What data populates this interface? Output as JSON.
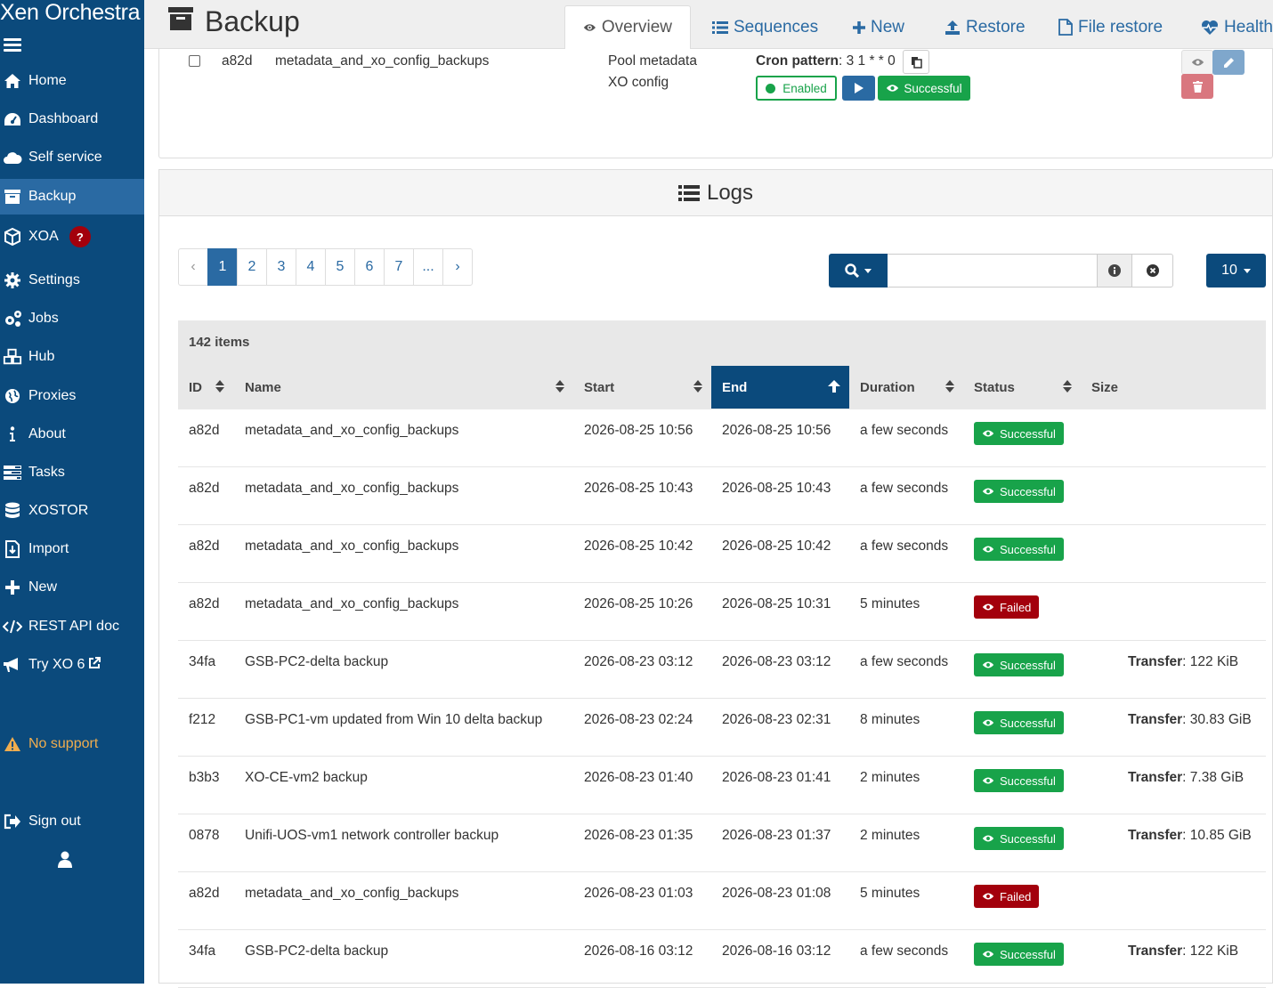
{
  "app": {
    "brand": "Xen Orchestra"
  },
  "sidebar": {
    "items": [
      {
        "label": "Home",
        "icon": "home-icon"
      },
      {
        "label": "Dashboard",
        "icon": "dashboard-icon"
      },
      {
        "label": "Self service",
        "icon": "cloud-icon"
      },
      {
        "label": "Backup",
        "icon": "archive-icon",
        "active": true
      },
      {
        "label": "XOA",
        "icon": "cube-icon",
        "badge": "?"
      },
      {
        "label": "Settings",
        "icon": "gear-icon"
      },
      {
        "label": "Jobs",
        "icon": "gears-icon"
      },
      {
        "label": "Hub",
        "icon": "cubes-icon"
      },
      {
        "label": "Proxies",
        "icon": "globe-icon"
      },
      {
        "label": "About",
        "icon": "info-icon"
      },
      {
        "label": "Tasks",
        "icon": "tasks-icon"
      },
      {
        "label": "XOSTOR",
        "icon": "database-icon"
      },
      {
        "label": "Import",
        "icon": "file-import-icon"
      },
      {
        "label": "New",
        "icon": "plus-icon"
      },
      {
        "label": "REST API doc",
        "icon": "code-icon"
      },
      {
        "label": "Try XO 6",
        "icon": "bullhorn-icon"
      }
    ],
    "no_support": "No support",
    "sign_out": "Sign out"
  },
  "header": {
    "title": "Backup",
    "tabs": [
      {
        "label": "Overview",
        "icon": "eye-icon",
        "active": true
      },
      {
        "label": "Sequences",
        "icon": "list-icon"
      },
      {
        "label": "New",
        "icon": "plus-icon"
      },
      {
        "label": "Restore",
        "icon": "upload-icon"
      },
      {
        "label": "File restore",
        "icon": "file-icon"
      },
      {
        "label": "Health",
        "icon": "heartbeat-icon"
      }
    ]
  },
  "job": {
    "id": "a82d",
    "name": "metadata_and_xo_config_backups",
    "mode_line1": "Pool metadata",
    "mode_line2": "XO config",
    "cron_label": "Cron pattern",
    "cron_value": ": 3 1 * * 0",
    "enabled_label": "Enabled",
    "last_status": "Successful"
  },
  "logs": {
    "title": "Logs",
    "pages": [
      "‹",
      "1",
      "2",
      "3",
      "4",
      "5",
      "6",
      "7",
      "...",
      "›"
    ],
    "active_page": "1",
    "search_value": "",
    "per_page": "10",
    "items_count": "142 items",
    "columns": [
      "ID",
      "Name",
      "Start",
      "End",
      "Duration",
      "Status",
      "Size"
    ],
    "sorted_column": "End",
    "rows": [
      {
        "id": "a82d",
        "name": "metadata_and_xo_config_backups",
        "start": "2026-08-25 10:56",
        "end": "2026-08-25 10:56",
        "duration": "a few seconds",
        "status": "Successful",
        "size_label": "",
        "size_value": ""
      },
      {
        "id": "a82d",
        "name": "metadata_and_xo_config_backups",
        "start": "2026-08-25 10:43",
        "end": "2026-08-25 10:43",
        "duration": "a few seconds",
        "status": "Successful",
        "size_label": "",
        "size_value": ""
      },
      {
        "id": "a82d",
        "name": "metadata_and_xo_config_backups",
        "start": "2026-08-25 10:42",
        "end": "2026-08-25 10:42",
        "duration": "a few seconds",
        "status": "Successful",
        "size_label": "",
        "size_value": ""
      },
      {
        "id": "a82d",
        "name": "metadata_and_xo_config_backups",
        "start": "2026-08-25 10:26",
        "end": "2026-08-25 10:31",
        "duration": "5 minutes",
        "status": "Failed",
        "size_label": "",
        "size_value": ""
      },
      {
        "id": "34fa",
        "name": "GSB-PC2-delta backup",
        "start": "2026-08-23 03:12",
        "end": "2026-08-23 03:12",
        "duration": "a few seconds",
        "status": "Successful",
        "size_label": "Transfer",
        "size_value": ": 122 KiB"
      },
      {
        "id": "f212",
        "name": "GSB-PC1-vm updated from Win 10 delta backup",
        "start": "2026-08-23 02:24",
        "end": "2026-08-23 02:31",
        "duration": "8 minutes",
        "status": "Successful",
        "size_label": "Transfer",
        "size_value": ": 30.83 GiB"
      },
      {
        "id": "b3b3",
        "name": "XO-CE-vm2 backup",
        "start": "2026-08-23 01:40",
        "end": "2026-08-23 01:41",
        "duration": "2 minutes",
        "status": "Successful",
        "size_label": "Transfer",
        "size_value": ": 7.38 GiB"
      },
      {
        "id": "0878",
        "name": "Unifi-UOS-vm1 network controller backup",
        "start": "2026-08-23 01:35",
        "end": "2026-08-23 01:37",
        "duration": "2 minutes",
        "status": "Successful",
        "size_label": "Transfer",
        "size_value": ": 10.85 GiB"
      },
      {
        "id": "a82d",
        "name": "metadata_and_xo_config_backups",
        "start": "2026-08-23 01:03",
        "end": "2026-08-23 01:08",
        "duration": "5 minutes",
        "status": "Failed",
        "size_label": "",
        "size_value": ""
      },
      {
        "id": "34fa",
        "name": "GSB-PC2-delta backup",
        "start": "2026-08-16 03:12",
        "end": "2026-08-16 03:12",
        "duration": "a few seconds",
        "status": "Successful",
        "size_label": "Transfer",
        "size_value": ": 122 KiB"
      }
    ]
  },
  "colors": {
    "sidebar": "#0b4a7c",
    "success": "#18a34a",
    "danger": "#a3000c",
    "link": "#2a6aa3"
  }
}
